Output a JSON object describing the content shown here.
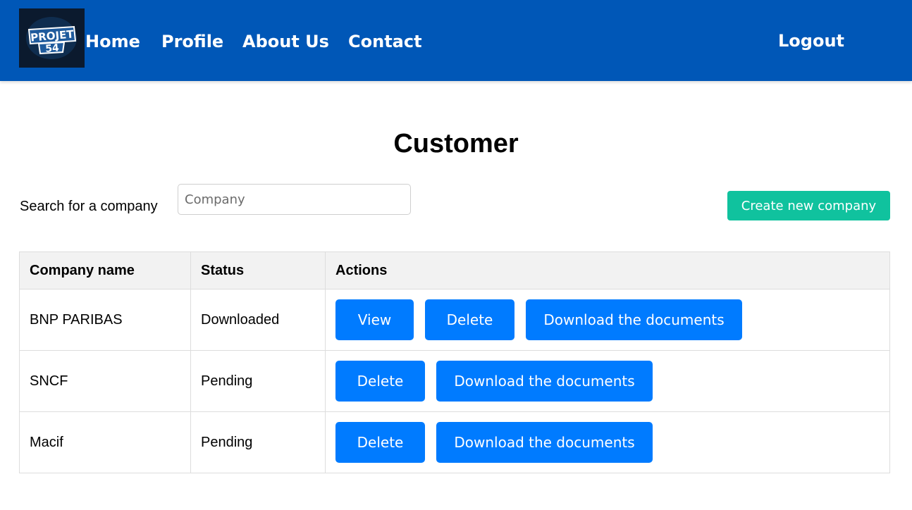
{
  "navbar": {
    "logo_text": "PROJET 54",
    "links": {
      "home": "Home",
      "profile": "Profile",
      "about": "About Us",
      "contact": "Contact"
    },
    "logout": "Logout",
    "color": "#0057b7"
  },
  "page": {
    "title": "Customer"
  },
  "search": {
    "label": "Search for a company",
    "placeholder": "Company",
    "value": ""
  },
  "create_button": {
    "label": "Create new company",
    "color": "#10c29e"
  },
  "table": {
    "headers": {
      "name": "Company name",
      "status": "Status",
      "actions": "Actions"
    },
    "rows": [
      {
        "name": "BNP PARIBAS",
        "status": "Downloaded",
        "actions": {
          "view": "View",
          "delete": "Delete",
          "download": "Download the documents"
        }
      },
      {
        "name": "SNCF",
        "status": "Pending",
        "actions": {
          "delete": "Delete",
          "download": "Download the documents"
        }
      },
      {
        "name": "Macif",
        "status": "Pending",
        "actions": {
          "delete": "Delete",
          "download": "Download the documents"
        }
      }
    ],
    "button_color": "#007bff"
  }
}
